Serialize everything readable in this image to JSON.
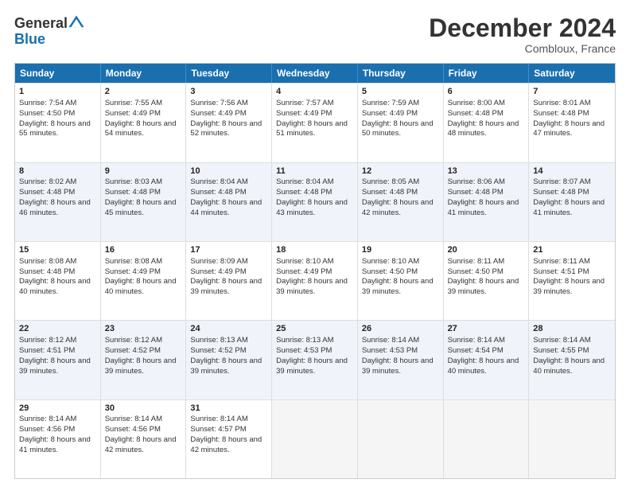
{
  "header": {
    "logo_general": "General",
    "logo_blue": "Blue",
    "month": "December 2024",
    "location": "Combloux, France"
  },
  "days": [
    "Sunday",
    "Monday",
    "Tuesday",
    "Wednesday",
    "Thursday",
    "Friday",
    "Saturday"
  ],
  "weeks": [
    [
      {
        "day": "1",
        "sunrise": "7:54 AM",
        "sunset": "4:50 PM",
        "daylight": "8 hours and 55 minutes."
      },
      {
        "day": "2",
        "sunrise": "7:55 AM",
        "sunset": "4:49 PM",
        "daylight": "8 hours and 54 minutes."
      },
      {
        "day": "3",
        "sunrise": "7:56 AM",
        "sunset": "4:49 PM",
        "daylight": "8 hours and 52 minutes."
      },
      {
        "day": "4",
        "sunrise": "7:57 AM",
        "sunset": "4:49 PM",
        "daylight": "8 hours and 51 minutes."
      },
      {
        "day": "5",
        "sunrise": "7:59 AM",
        "sunset": "4:49 PM",
        "daylight": "8 hours and 50 minutes."
      },
      {
        "day": "6",
        "sunrise": "8:00 AM",
        "sunset": "4:48 PM",
        "daylight": "8 hours and 48 minutes."
      },
      {
        "day": "7",
        "sunrise": "8:01 AM",
        "sunset": "4:48 PM",
        "daylight": "8 hours and 47 minutes."
      }
    ],
    [
      {
        "day": "8",
        "sunrise": "8:02 AM",
        "sunset": "4:48 PM",
        "daylight": "8 hours and 46 minutes."
      },
      {
        "day": "9",
        "sunrise": "8:03 AM",
        "sunset": "4:48 PM",
        "daylight": "8 hours and 45 minutes."
      },
      {
        "day": "10",
        "sunrise": "8:04 AM",
        "sunset": "4:48 PM",
        "daylight": "8 hours and 44 minutes."
      },
      {
        "day": "11",
        "sunrise": "8:04 AM",
        "sunset": "4:48 PM",
        "daylight": "8 hours and 43 minutes."
      },
      {
        "day": "12",
        "sunrise": "8:05 AM",
        "sunset": "4:48 PM",
        "daylight": "8 hours and 42 minutes."
      },
      {
        "day": "13",
        "sunrise": "8:06 AM",
        "sunset": "4:48 PM",
        "daylight": "8 hours and 41 minutes."
      },
      {
        "day": "14",
        "sunrise": "8:07 AM",
        "sunset": "4:48 PM",
        "daylight": "8 hours and 41 minutes."
      }
    ],
    [
      {
        "day": "15",
        "sunrise": "8:08 AM",
        "sunset": "4:48 PM",
        "daylight": "8 hours and 40 minutes."
      },
      {
        "day": "16",
        "sunrise": "8:08 AM",
        "sunset": "4:49 PM",
        "daylight": "8 hours and 40 minutes."
      },
      {
        "day": "17",
        "sunrise": "8:09 AM",
        "sunset": "4:49 PM",
        "daylight": "8 hours and 39 minutes."
      },
      {
        "day": "18",
        "sunrise": "8:10 AM",
        "sunset": "4:49 PM",
        "daylight": "8 hours and 39 minutes."
      },
      {
        "day": "19",
        "sunrise": "8:10 AM",
        "sunset": "4:50 PM",
        "daylight": "8 hours and 39 minutes."
      },
      {
        "day": "20",
        "sunrise": "8:11 AM",
        "sunset": "4:50 PM",
        "daylight": "8 hours and 39 minutes."
      },
      {
        "day": "21",
        "sunrise": "8:11 AM",
        "sunset": "4:51 PM",
        "daylight": "8 hours and 39 minutes."
      }
    ],
    [
      {
        "day": "22",
        "sunrise": "8:12 AM",
        "sunset": "4:51 PM",
        "daylight": "8 hours and 39 minutes."
      },
      {
        "day": "23",
        "sunrise": "8:12 AM",
        "sunset": "4:52 PM",
        "daylight": "8 hours and 39 minutes."
      },
      {
        "day": "24",
        "sunrise": "8:13 AM",
        "sunset": "4:52 PM",
        "daylight": "8 hours and 39 minutes."
      },
      {
        "day": "25",
        "sunrise": "8:13 AM",
        "sunset": "4:53 PM",
        "daylight": "8 hours and 39 minutes."
      },
      {
        "day": "26",
        "sunrise": "8:14 AM",
        "sunset": "4:53 PM",
        "daylight": "8 hours and 39 minutes."
      },
      {
        "day": "27",
        "sunrise": "8:14 AM",
        "sunset": "4:54 PM",
        "daylight": "8 hours and 40 minutes."
      },
      {
        "day": "28",
        "sunrise": "8:14 AM",
        "sunset": "4:55 PM",
        "daylight": "8 hours and 40 minutes."
      }
    ],
    [
      {
        "day": "29",
        "sunrise": "8:14 AM",
        "sunset": "4:56 PM",
        "daylight": "8 hours and 41 minutes."
      },
      {
        "day": "30",
        "sunrise": "8:14 AM",
        "sunset": "4:56 PM",
        "daylight": "8 hours and 42 minutes."
      },
      {
        "day": "31",
        "sunrise": "8:14 AM",
        "sunset": "4:57 PM",
        "daylight": "8 hours and 42 minutes."
      },
      null,
      null,
      null,
      null
    ]
  ],
  "labels": {
    "sunrise": "Sunrise:",
    "sunset": "Sunset:",
    "daylight": "Daylight:"
  }
}
